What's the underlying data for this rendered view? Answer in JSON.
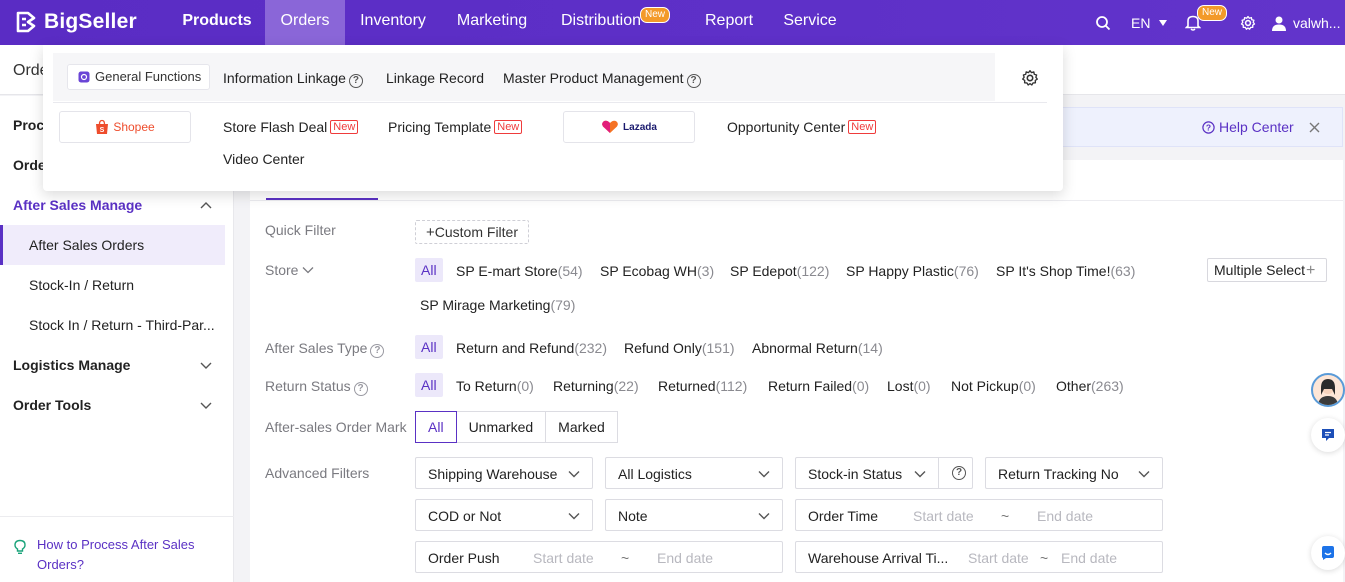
{
  "brand": {
    "name": "BigSeller"
  },
  "nav": {
    "items": [
      {
        "label": "Products"
      },
      {
        "label": "Orders"
      },
      {
        "label": "Inventory"
      },
      {
        "label": "Marketing"
      },
      {
        "label": "Distribution",
        "badge": "New"
      },
      {
        "label": "Report"
      },
      {
        "label": "Service"
      }
    ],
    "language": "EN",
    "notif_badge": "New",
    "user": "valwh..."
  },
  "page_title": "Orde",
  "dropdown": {
    "general_functions": "General Functions",
    "row1_links": [
      "Information Linkage",
      "Linkage Record",
      "Master Product Management"
    ],
    "shopee": {
      "brand": "Shopee",
      "links": [
        {
          "label": "Store Flash Deal",
          "tag": "New"
        },
        {
          "label": "Pricing Template",
          "tag": "New"
        },
        {
          "label": "Video Center"
        }
      ]
    },
    "lazada": {
      "brand": "Lazada",
      "links": [
        {
          "label": "Opportunity Center",
          "tag": "New"
        }
      ]
    }
  },
  "sidebar": {
    "items": [
      {
        "label": "Proc"
      },
      {
        "label": "Orde"
      },
      {
        "label": "After Sales Manage"
      },
      {
        "label": "After Sales Orders"
      },
      {
        "label": "Stock-In / Return"
      },
      {
        "label": "Stock In / Return - Third-Par..."
      },
      {
        "label": "Logistics Manage"
      },
      {
        "label": "Order Tools"
      }
    ],
    "help_text": "How to Process After Sales Orders?"
  },
  "banner": {
    "help_center": "Help Center"
  },
  "filters": {
    "quick_filter": {
      "label": "Quick Filter",
      "button": "Custom Filter"
    },
    "store": {
      "label": "Store",
      "all": "All",
      "options": [
        {
          "name": "SP E-mart Store",
          "count": "(54)"
        },
        {
          "name": "SP Ecobag WH",
          "count": "(3)"
        },
        {
          "name": "SP Edepot",
          "count": "(122)"
        },
        {
          "name": "SP Happy Plastic",
          "count": "(76)"
        },
        {
          "name": "SP It's Shop Time!",
          "count": "(63)"
        },
        {
          "name": "SP Mirage Marketing",
          "count": "(79)"
        }
      ],
      "multi_select": "Multiple Select"
    },
    "after_sales_type": {
      "label": "After Sales Type",
      "all": "All",
      "options": [
        {
          "name": "Return and Refund",
          "count": "(232)"
        },
        {
          "name": "Refund Only",
          "count": "(151)"
        },
        {
          "name": "Abnormal Return",
          "count": "(14)"
        }
      ]
    },
    "return_status": {
      "label": "Return Status",
      "all": "All",
      "options": [
        {
          "name": "To Return",
          "count": "(0)"
        },
        {
          "name": "Returning",
          "count": "(22)"
        },
        {
          "name": "Returned",
          "count": "(112)"
        },
        {
          "name": "Return Failed",
          "count": "(0)"
        },
        {
          "name": "Lost",
          "count": "(0)"
        },
        {
          "name": "Not Pickup",
          "count": "(0)"
        },
        {
          "name": "Other",
          "count": "(263)"
        }
      ]
    },
    "order_mark": {
      "label": "After-sales Order Mark",
      "options": [
        "All",
        "Unmarked",
        "Marked"
      ]
    },
    "advanced": {
      "label": "Advanced Filters",
      "selects": [
        "Shipping Warehouse",
        "All Logistics",
        "Stock-in Status",
        "Return Tracking No",
        "COD or Not",
        "Note"
      ],
      "order_time": "Order Time",
      "order_push": "Order Push",
      "warehouse_arrival": "Warehouse Arrival Ti...",
      "start_date": "Start date",
      "end_date": "End date",
      "tilde": "~"
    }
  }
}
